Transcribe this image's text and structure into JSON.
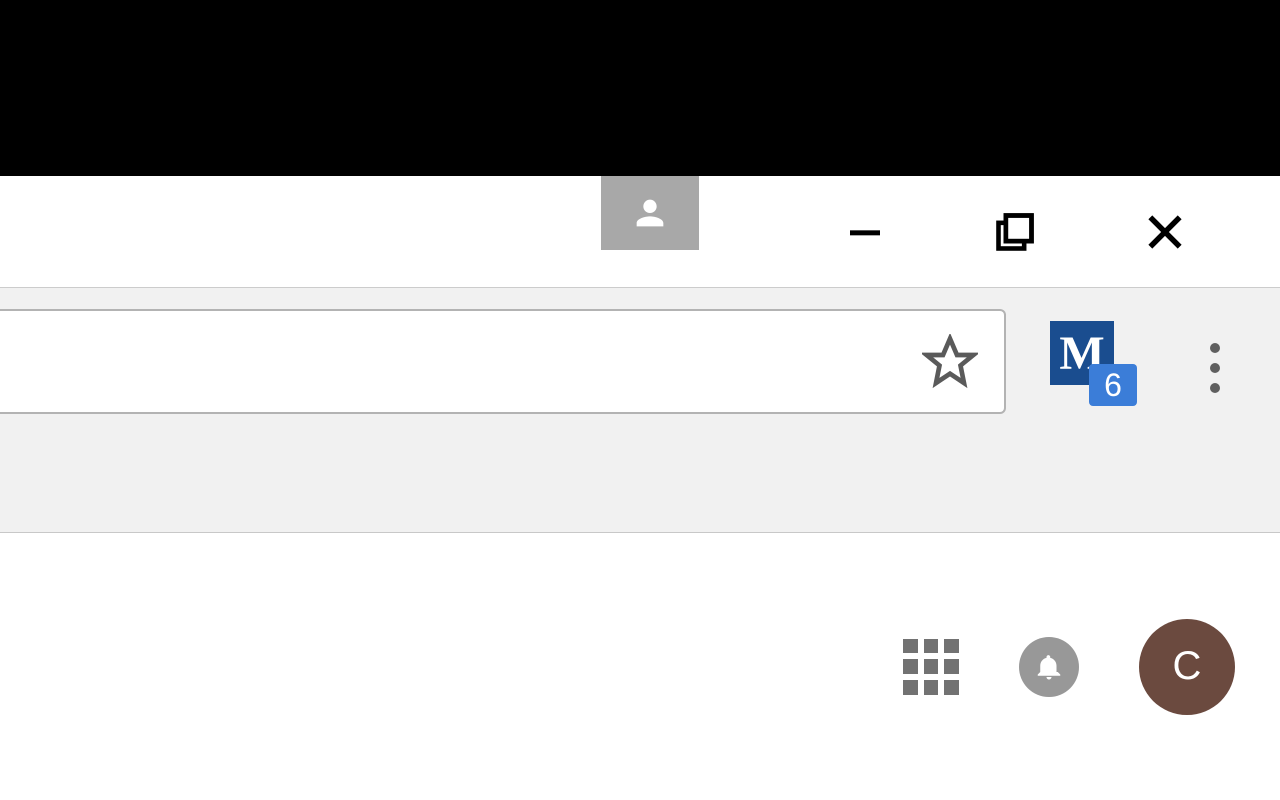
{
  "window": {
    "profile_icon": "person-icon",
    "controls": {
      "minimize": "−",
      "maximize": "⧉",
      "close": "×"
    }
  },
  "toolbar": {
    "omnibox_value": "",
    "star_label": "Bookmark",
    "extension": {
      "letter": "M",
      "badge": "6"
    },
    "menu_label": "Menu"
  },
  "page": {
    "apps_label": "Apps",
    "notifications_label": "Notifications",
    "avatar_initial": "C"
  },
  "colors": {
    "extension_bg": "#1a4d8f",
    "badge_bg": "#3b7dd8",
    "avatar_bg": "#6b4a3f"
  }
}
